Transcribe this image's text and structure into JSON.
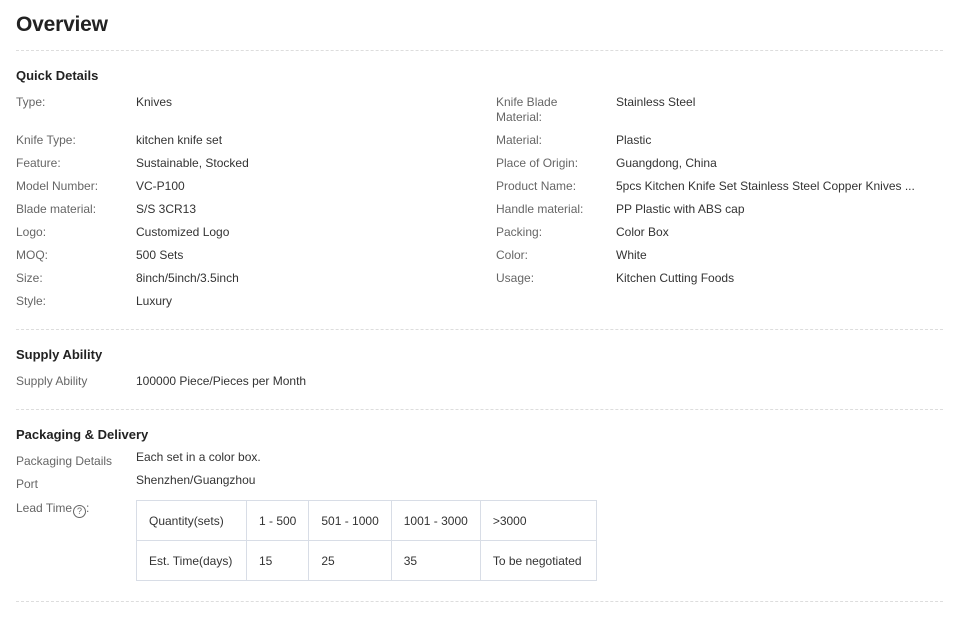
{
  "overview": {
    "title": "Overview"
  },
  "quick_details": {
    "title": "Quick Details",
    "left": [
      {
        "label": "Type:",
        "value": "Knives"
      },
      {
        "label": "Knife Type:",
        "value": "kitchen knife set"
      },
      {
        "label": "Feature:",
        "value": "Sustainable, Stocked"
      },
      {
        "label": "Model Number:",
        "value": "VC-P100"
      },
      {
        "label": "Blade material:",
        "value": "S/S 3CR13"
      },
      {
        "label": "Logo:",
        "value": "Customized Logo"
      },
      {
        "label": "MOQ:",
        "value": "500 Sets"
      },
      {
        "label": "Size:",
        "value": "8inch/5inch/3.5inch"
      },
      {
        "label": "Style:",
        "value": "Luxury"
      }
    ],
    "right": [
      {
        "label_line1": "Knife Blade",
        "label_line2": "Material:",
        "value": "Stainless Steel"
      },
      {
        "label": "Material:",
        "value": "Plastic"
      },
      {
        "label": "Place of Origin:",
        "value": "Guangdong, China"
      },
      {
        "label": "Product Name:",
        "value": "5pcs Kitchen Knife Set Stainless Steel Copper Knives ..."
      },
      {
        "label": "Handle material:",
        "value": "PP Plastic with ABS cap"
      },
      {
        "label": "Packing:",
        "value": "Color Box"
      },
      {
        "label": "Color:",
        "value": "White"
      },
      {
        "label": "Usage:",
        "value": "Kitchen Cutting Foods"
      }
    ]
  },
  "supply_ability": {
    "title": "Supply Ability",
    "label": "Supply Ability",
    "value": "100000 Piece/Pieces per Month"
  },
  "packaging_delivery": {
    "title": "Packaging & Delivery",
    "details_label": "Packaging Details",
    "details_value": "Each set in a color box.",
    "port_label": "Port",
    "port_value": "Shenzhen/Guangzhou",
    "lead_time_label": "Lead Time",
    "help_glyph": "?",
    "lead_table": {
      "row_quantity": [
        "Quantity(sets)",
        "1 - 500",
        "501 - 1000",
        "1001 - 3000",
        ">3000"
      ],
      "row_time": [
        "Est. Time(days)",
        "15",
        "25",
        "35",
        "To be negotiated"
      ]
    }
  }
}
